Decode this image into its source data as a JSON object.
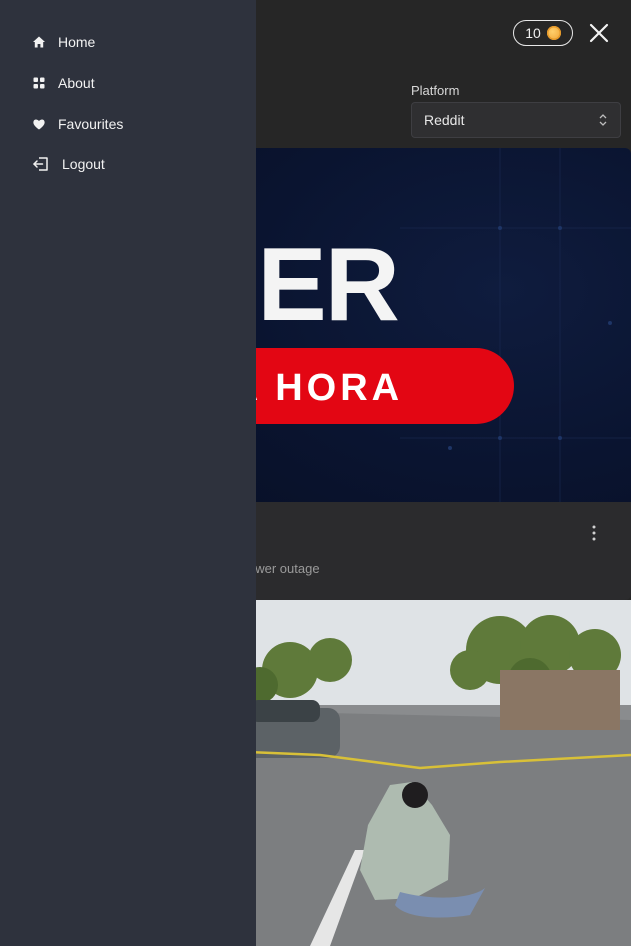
{
  "header": {
    "coin_count": "10",
    "close_icon": "close-icon"
  },
  "filter": {
    "platform_label": "Platform",
    "platform_value": "Reddit"
  },
  "cards": [
    {
      "image_text_line1": "SER",
      "image_text_line2": "MA HORA",
      "description": "ower outage"
    },
    {
      "image": "street-scene-photo"
    }
  ],
  "drawer": {
    "items": [
      {
        "label": "Home",
        "icon": "home-icon"
      },
      {
        "label": "About",
        "icon": "grid-icon"
      },
      {
        "label": "Favourites",
        "icon": "heart-icon"
      },
      {
        "label": "Logout",
        "icon": "logout-icon"
      }
    ]
  },
  "colors": {
    "drawer_bg": "#2e323d",
    "page_bg": "#262626",
    "banner_red": "#e30613",
    "banner_navy": "#0a1430",
    "coin_gold": "#f0a030"
  }
}
